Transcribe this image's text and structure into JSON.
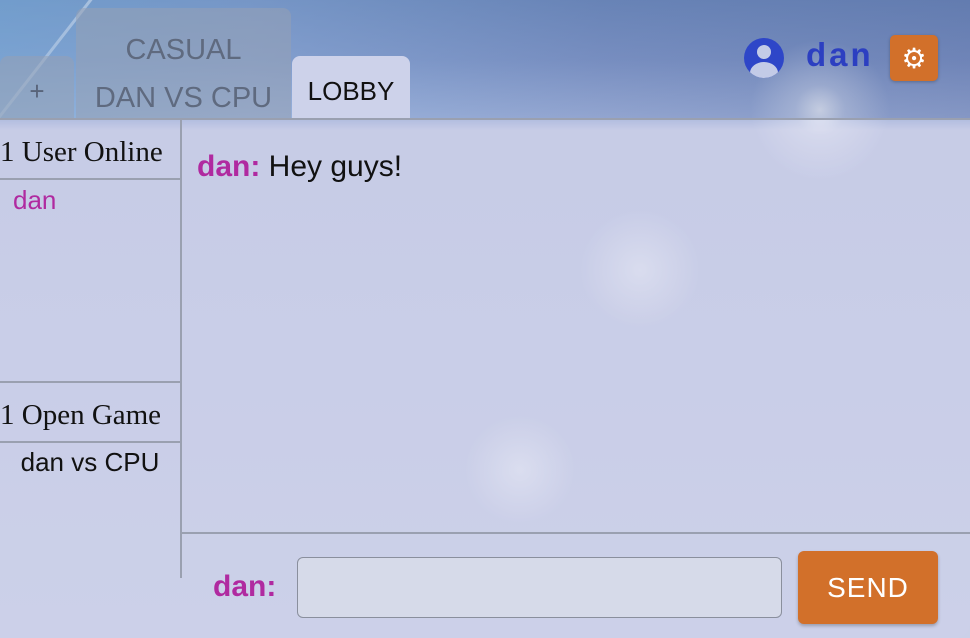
{
  "tabs": {
    "add_label": "+",
    "casual_line1": "CASUAL",
    "casual_line2": "DAN VS CPU",
    "lobby_label": "LOBBY"
  },
  "user": {
    "name": "dan",
    "avatar_icon": "account-circle-icon",
    "settings_icon": "gear-icon"
  },
  "sidebar": {
    "online_title": "1 User Online",
    "online_users": [
      "dan"
    ],
    "games_title": "1 Open Game",
    "open_games": [
      "dan vs CPU"
    ]
  },
  "chat": {
    "messages": [
      {
        "sender": "dan:",
        "text": "Hey guys!"
      }
    ],
    "input_label": "dan:",
    "input_value": "",
    "send_label": "SEND"
  },
  "colors": {
    "accent": "#d2702a",
    "username": "#2c3fc1",
    "chat_name": "#b02aa0"
  }
}
